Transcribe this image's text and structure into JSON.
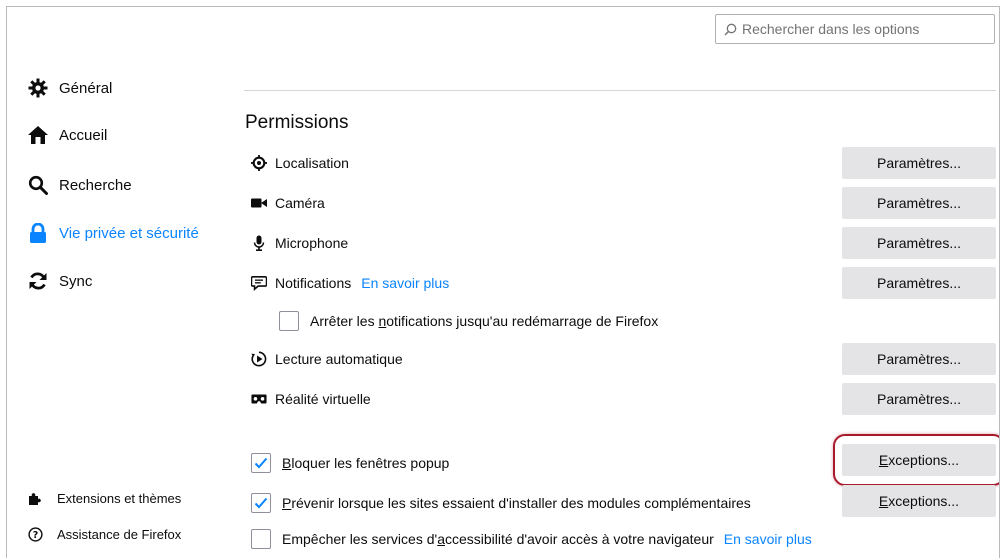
{
  "search": {
    "placeholder": "Rechercher dans les options",
    "icon": "search-icon"
  },
  "sidebar": {
    "items": [
      {
        "label": "Général",
        "icon": "gear-icon",
        "active": false
      },
      {
        "label": "Accueil",
        "icon": "home-icon",
        "active": false
      },
      {
        "label": "Recherche",
        "icon": "search-icon",
        "active": false
      },
      {
        "label": "Vie privée et sécurité",
        "icon": "lock-icon",
        "active": true
      },
      {
        "label": "Sync",
        "icon": "sync-icon",
        "active": false
      }
    ],
    "footer": [
      {
        "label": "Extensions et thèmes",
        "icon": "puzzle-icon"
      },
      {
        "label": "Assistance de Firefox",
        "icon": "help-icon"
      }
    ]
  },
  "permissions": {
    "title": "Permissions",
    "rows": [
      {
        "label": "Localisation",
        "icon": "location-icon",
        "button": "Paramètres..."
      },
      {
        "label": "Caméra",
        "icon": "camera-icon",
        "button": "Paramètres..."
      },
      {
        "label": "Microphone",
        "icon": "microphone-icon",
        "button": "Paramètres..."
      },
      {
        "label": "Notifications",
        "icon": "notification-icon",
        "link": "En savoir plus",
        "button": "Paramètres..."
      },
      {
        "label": "Lecture automatique",
        "icon": "autoplay-icon",
        "button": "Paramètres..."
      },
      {
        "label": "Réalité virtuelle",
        "icon": "vr-icon",
        "button": "Paramètres..."
      }
    ],
    "pause_notifications": {
      "pre": "Arrêter les ",
      "u": "n",
      "post": "otifications jusqu'au redémarrage de Firefox",
      "checked": false
    },
    "block_popups": {
      "u": "B",
      "post": "loquer les fenêtres popup",
      "checked": true,
      "button_u": "E",
      "button_post": "xceptions..."
    },
    "warn_addons": {
      "u": "P",
      "post": "révenir lorsque les sites essaient d'installer des modules complémentaires",
      "checked": true,
      "button_u": "E",
      "button_post": "xceptions..."
    },
    "accessibility": {
      "pre": "Empêcher les services d'",
      "u": "a",
      "post": "ccessibilité d'avoir accès à votre navigateur",
      "link": "En savoir plus",
      "checked": false
    }
  },
  "colors": {
    "accent": "#0a84ff",
    "highlight_ring": "#a8192b",
    "button_bg": "#e4e4e6"
  }
}
